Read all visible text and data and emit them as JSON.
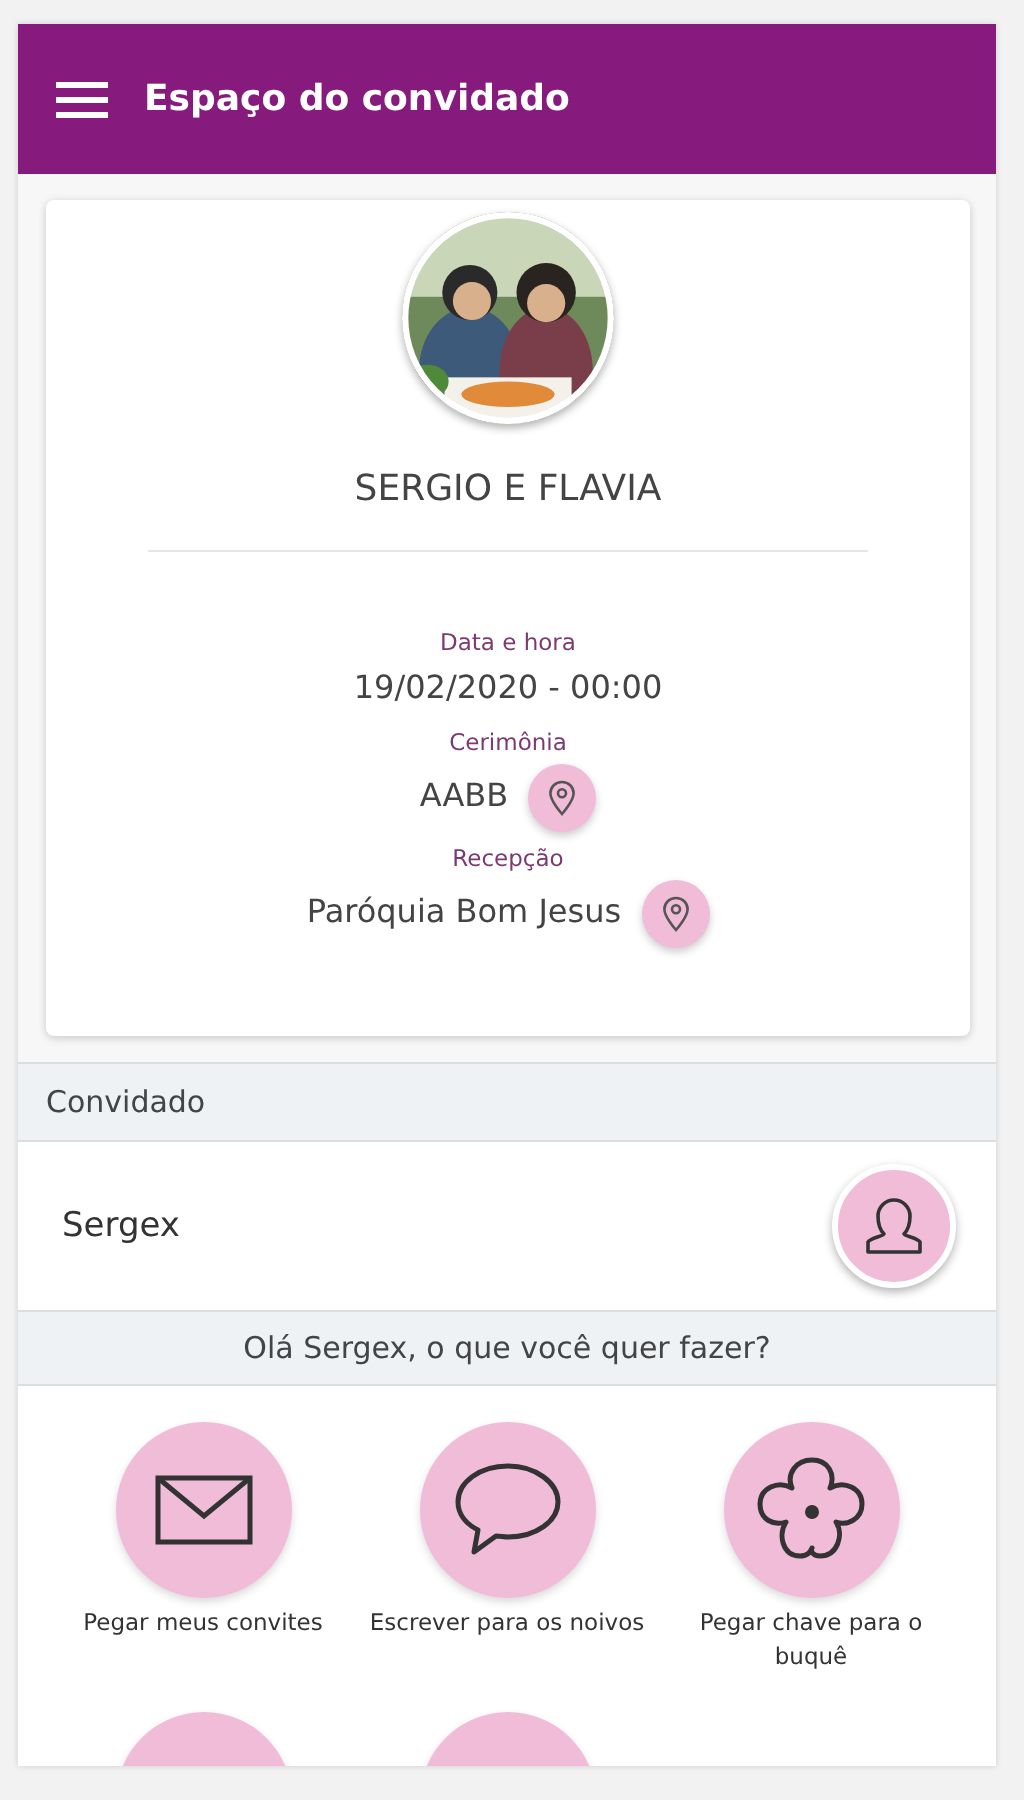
{
  "app_bar": {
    "title": "Espaço do convidado"
  },
  "event": {
    "kind": "picture",
    "couple": "SERGIO E FLAVIA",
    "details": [
      {
        "label": "Data e hora",
        "value": "19/02/2020 - 00:00",
        "has_location": false
      },
      {
        "label": "Cerimônia",
        "value": "AABB",
        "has_location": true
      },
      {
        "label": "Recepção",
        "value": "Paróquia Bom Jesus",
        "has_location": true
      }
    ]
  },
  "guest": {
    "section_title": "Convidado",
    "name": "Sergex"
  },
  "greeting": "Olá Sergex, o que você quer fazer?",
  "actions": [
    {
      "kind": "envelope",
      "label": "Pegar meus convites"
    },
    {
      "kind": "speech",
      "label": "Escrever para os noivos"
    },
    {
      "kind": "flower",
      "label": "Pegar chave para o buquê"
    },
    {
      "kind": "clipped"
    },
    {
      "kind": "clipped"
    }
  ]
}
